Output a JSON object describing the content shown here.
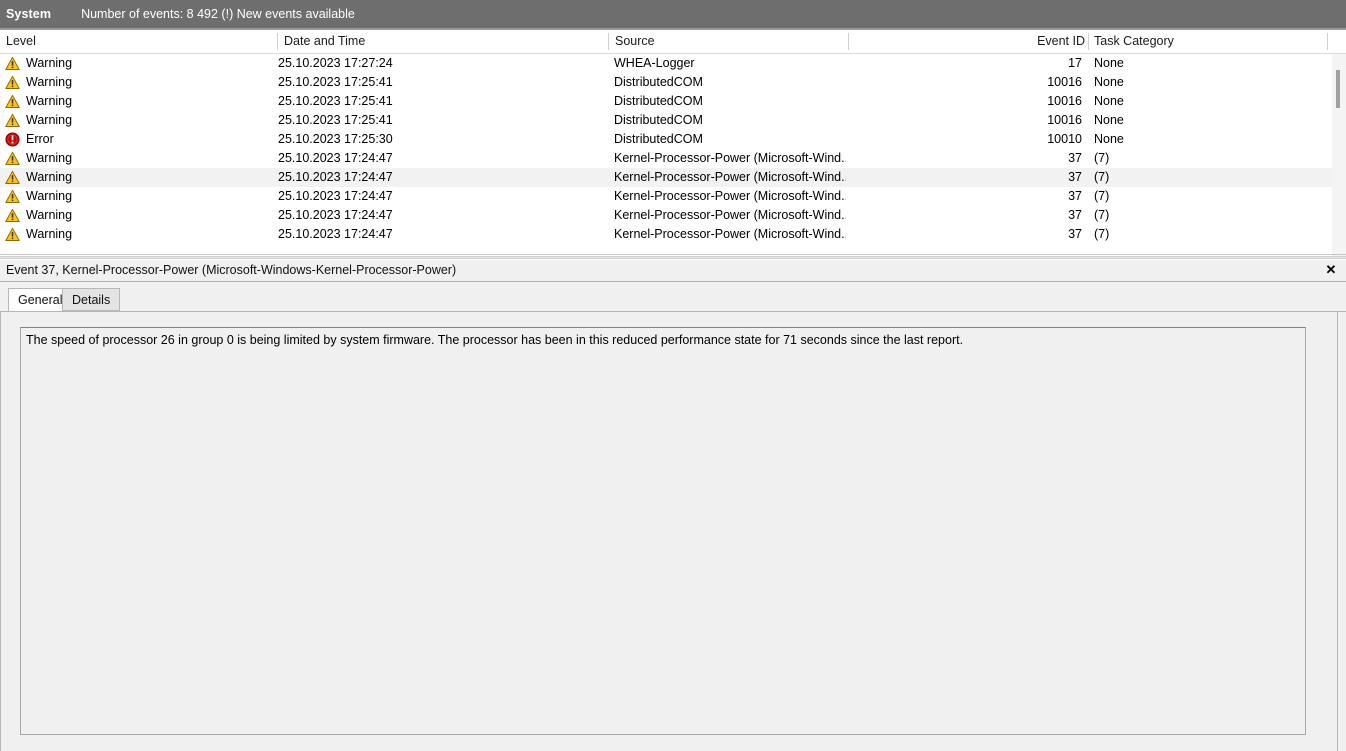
{
  "header": {
    "log_name": "System",
    "events_status": "Number of events: 8 492 (!) New events available",
    "bar_color": "#6e6e6e"
  },
  "event_list": {
    "columns": [
      {
        "key": "level",
        "label": "Level"
      },
      {
        "key": "datetime",
        "label": "Date and Time"
      },
      {
        "key": "source",
        "label": "Source"
      },
      {
        "key": "event_id",
        "label": "Event ID"
      },
      {
        "key": "task_category",
        "label": "Task Category"
      }
    ],
    "rows": [
      {
        "icon": "warning-icon",
        "level": "Warning",
        "datetime": "25.10.2023 17:27:24",
        "source": "WHEA-Logger",
        "event_id": "17",
        "task_category": "None",
        "selected": false
      },
      {
        "icon": "warning-icon",
        "level": "Warning",
        "datetime": "25.10.2023 17:25:41",
        "source": "DistributedCOM",
        "event_id": "10016",
        "task_category": "None",
        "selected": false
      },
      {
        "icon": "warning-icon",
        "level": "Warning",
        "datetime": "25.10.2023 17:25:41",
        "source": "DistributedCOM",
        "event_id": "10016",
        "task_category": "None",
        "selected": false
      },
      {
        "icon": "warning-icon",
        "level": "Warning",
        "datetime": "25.10.2023 17:25:41",
        "source": "DistributedCOM",
        "event_id": "10016",
        "task_category": "None",
        "selected": false
      },
      {
        "icon": "error-icon",
        "level": "Error",
        "datetime": "25.10.2023 17:25:30",
        "source": "DistributedCOM",
        "event_id": "10010",
        "task_category": "None",
        "selected": false
      },
      {
        "icon": "warning-icon",
        "level": "Warning",
        "datetime": "25.10.2023 17:24:47",
        "source": "Kernel-Processor-Power (Microsoft-Wind...",
        "event_id": "37",
        "task_category": "(7)",
        "selected": false
      },
      {
        "icon": "warning-icon",
        "level": "Warning",
        "datetime": "25.10.2023 17:24:47",
        "source": "Kernel-Processor-Power (Microsoft-Wind...",
        "event_id": "37",
        "task_category": "(7)",
        "selected": true
      },
      {
        "icon": "warning-icon",
        "level": "Warning",
        "datetime": "25.10.2023 17:24:47",
        "source": "Kernel-Processor-Power (Microsoft-Wind...",
        "event_id": "37",
        "task_category": "(7)",
        "selected": false
      },
      {
        "icon": "warning-icon",
        "level": "Warning",
        "datetime": "25.10.2023 17:24:47",
        "source": "Kernel-Processor-Power (Microsoft-Wind...",
        "event_id": "37",
        "task_category": "(7)",
        "selected": false
      },
      {
        "icon": "warning-icon",
        "level": "Warning",
        "datetime": "25.10.2023 17:24:47",
        "source": "Kernel-Processor-Power (Microsoft-Wind...",
        "event_id": "37",
        "task_category": "(7)",
        "selected": false
      }
    ]
  },
  "detail": {
    "title": "Event 37, Kernel-Processor-Power (Microsoft-Windows-Kernel-Processor-Power)",
    "close_label": "✕",
    "tabs": [
      {
        "label": "General",
        "active": true
      },
      {
        "label": "Details",
        "active": false
      }
    ],
    "description": "The speed of processor 26 in group 0 is being limited by system firmware. The processor has been in this reduced performance state for 71 seconds since the last report."
  },
  "colors": {
    "warning": "#ffc20e",
    "error": "#c80000",
    "selection": "#f2f2f2"
  }
}
